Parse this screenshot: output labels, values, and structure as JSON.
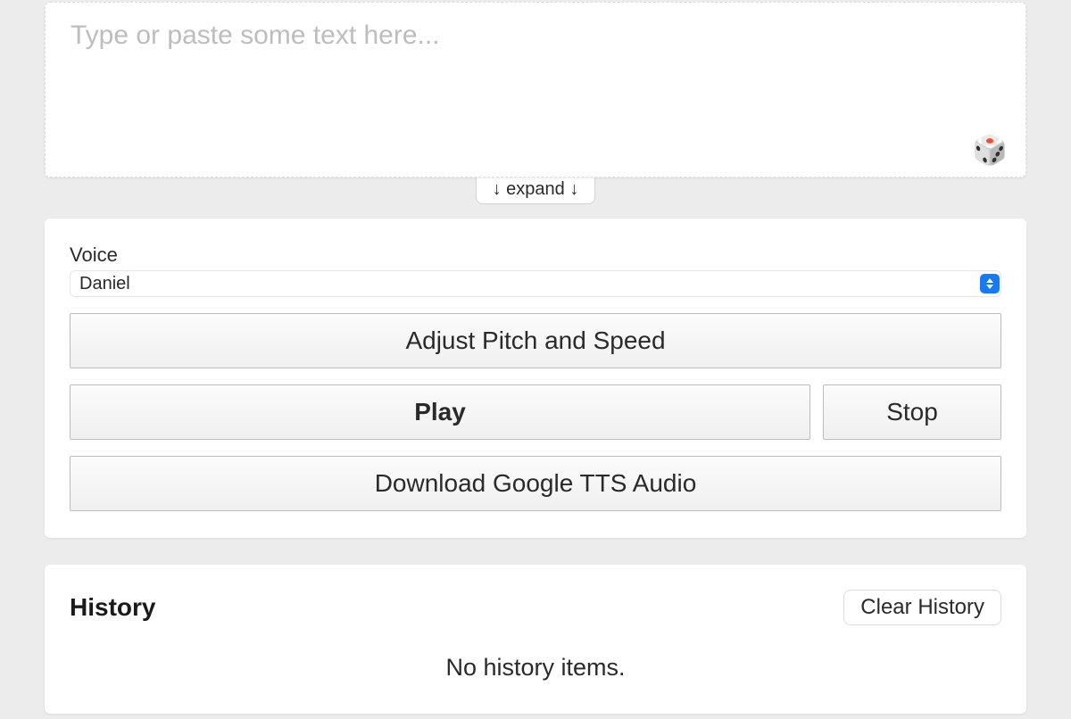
{
  "textInput": {
    "placeholder": "Type or paste some text here...",
    "value": ""
  },
  "expand": {
    "label": "↓ expand ↓"
  },
  "voice": {
    "label": "Voice",
    "selected": "Daniel"
  },
  "buttons": {
    "adjust": "Adjust Pitch and Speed",
    "play": "Play",
    "stop": "Stop",
    "download": "Download Google TTS Audio"
  },
  "history": {
    "title": "History",
    "clearLabel": "Clear History",
    "emptyMessage": "No history items."
  },
  "icons": {
    "dice": "🎲"
  }
}
